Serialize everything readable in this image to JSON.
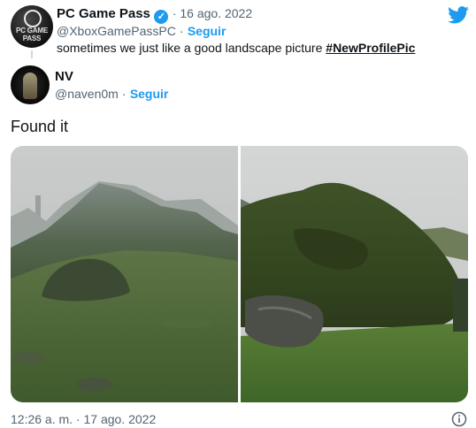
{
  "twitter_logo_icon": "twitter-bird-icon",
  "quoted": {
    "avatar_text": "PC GAME PASS",
    "name": "PC Game Pass",
    "verified_icon": "verified-badge-icon",
    "date": "· 16 ago. 2022",
    "handle": "@XboxGamePassPC ·",
    "follow": "Seguir",
    "text": "sometimes we just like a good landscape picture",
    "hashtag": "#NewProfilePic"
  },
  "author": {
    "name": "NV",
    "handle": "@naven0m ·",
    "follow": "Seguir"
  },
  "tweet_text": "Found it",
  "timestamp": "12:26 a. m. · 17 ago. 2022",
  "info_icon": "info-icon",
  "colors": {
    "link": "#1d9bf0",
    "muted": "#536471",
    "text": "#0f1419"
  }
}
